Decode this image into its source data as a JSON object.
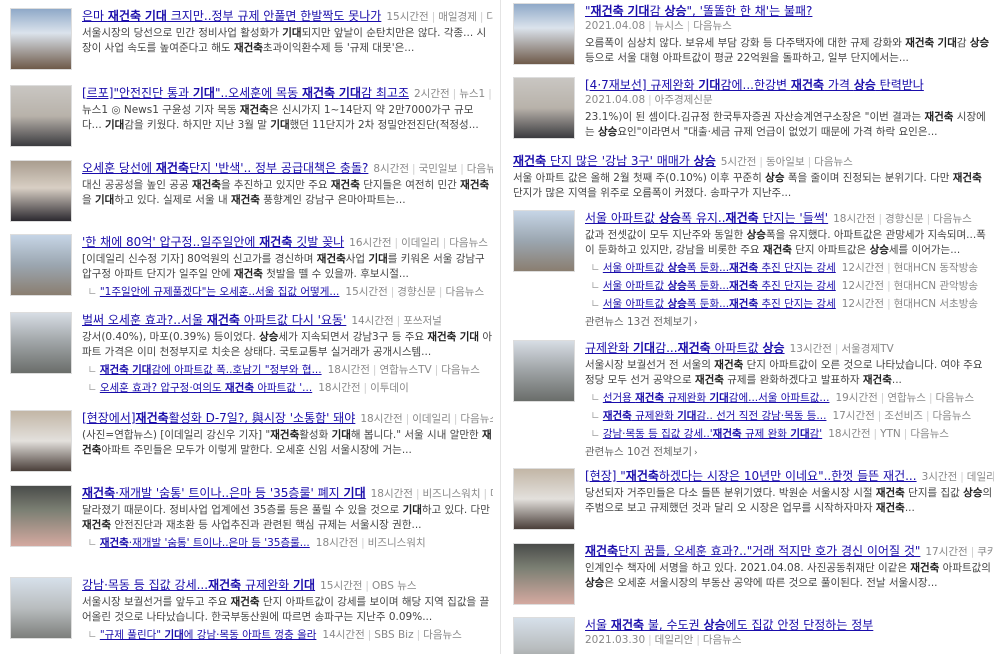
{
  "left": [
    {
      "id": "L1",
      "title": "은마 재건축 기대 크지만..정부 규제 안풀면 한발짝도 못나가",
      "time": "15시간전",
      "source": "매일경제",
      "portal": "다음뉴스",
      "snippet": "서울시장의 당선으로 민간 정비사업 활성화가 기대되지만 앞날이 순탄치만은 않다. 각종... 시장이 사업 속도를 높여준다고 해도 재건축초과이익환수제 등 '규제 대못'은..."
    },
    {
      "id": "L2",
      "title": "[르포]\"안전진단 통과 기대\"..오세훈에 목동 재건축 기대감 최고조",
      "time": "2시간전",
      "source": "뉴스1",
      "portal": "다음뉴스",
      "snippet": "뉴스1 ◎ News1 구윤성 기자 목동 재건축은 신시가지 1~14단지 약 2만7000가구 규모다... 기대감을 키웠다. 하지만 지난 3월 말 기대했던 11단지가 2차 정밀안전진단(적정성..."
    },
    {
      "id": "L3",
      "title": "오세훈 당선에 재건축단지 '반색'.. 정부 공급대책은 충돌?",
      "time": "8시간전",
      "source": "국민일보",
      "portal": "다음뉴스",
      "snippet": "대신 공공성을 높인 공공 재건축을 추진하고 있지만 주요 재건축 단지들은 여전히 민간 재건축을 기대하고 있다. 실제로 서울 내 재건축 풍향계인 강남구 은마아파트는..."
    },
    {
      "id": "L4",
      "title": "'한 채에 80억' 압구정..일주일안에 재건축 깃발 꽂나",
      "time": "16시간전",
      "source": "이데일리",
      "portal": "다음뉴스",
      "snippet": "[이데일리 신수정 기자] 80억원의 신고가를 경신하며 재건축사업 기대를 키워온 서울 강남구 압구정 아파트 단지가 일주일 안에 재건축 첫발을 뗄 수 있을까. 후보시절...",
      "related": [
        {
          "title": "\"1주일안에 규제풀겠다\"는 오세훈..서울 집값 어떻게...",
          "time": "15시간전",
          "source": "경향신문",
          "portal": "다음뉴스"
        }
      ]
    },
    {
      "id": "L5",
      "title": "벌써 오세훈 효과?..서울 재건축 아파트값 다시 '요동'",
      "time": "14시간전",
      "source": "포쓰저널",
      "portal": "",
      "snippet": "강서(0.40%), 마포(0.39%) 등이었다. 상승세가 지속되면서 강남3구 등 주요 재건축 기대 아파트 가격은 이미 천정부지로 치솟은 상태다. 국토교통부 실거래가 공개시스템...",
      "related": [
        {
          "title": "재건축 기대감에 아파트값 폭..호남기 \"정부와 협...",
          "time": "18시간전",
          "source": "연합뉴스TV",
          "portal": "다음뉴스"
        },
        {
          "title": "오세훈 효과? 압구정·여의도 재건축 아파트값 '...",
          "time": "18시간전",
          "source": "이투데이",
          "portal": ""
        }
      ]
    },
    {
      "id": "L6",
      "title": "[현장에서]재건축활성화 D-7일?, 與시장 '소통함' 돼야",
      "time": "18시간전",
      "source": "이데일리",
      "portal": "다음뉴스",
      "snippet": "(사진=연합뉴스) [이데일리 강신우 기자] \"재건축활성화 기대해 봅니다.\" 서울 시내 알만한 재건축아파트 주민들은 모두가 이렇게 말한다. 오세훈 신임 서울시장에 거는..."
    },
    {
      "id": "L7",
      "title": "재건축·재개발 '숨통' 트이나..은마 등 '35층룰' 폐지 기대",
      "time": "18시간전",
      "source": "비즈니스워치",
      "portal": "다음뉴스",
      "snippet": "달라졌기 때문이다. 정비사업 업계에선 35층룰 등은 풀릴 수 있을 것으로 기대하고 있다. 다만 재건축 안전진단과 재초환 등 사업추진과 관련된 핵심 규제는 서울시장 권한...",
      "related": [
        {
          "title": "재건축·재개발 '숨통' 트이나..은마 등 '35층룰...",
          "time": "18시간전",
          "source": "비즈니스워치",
          "portal": ""
        }
      ]
    },
    {
      "id": "L8",
      "title": "강남·목동 등 집값 강세...재건축 규제완화 기대",
      "time": "15시간전",
      "source": "OBS 뉴스",
      "portal": "",
      "snippet": "서울시장 보궐선거를 앞두고 주요 재건축 단지 아파트값이 강세를 보이며 해당 지역 집값을 끌어올린 것으로 나타났습니다. 한국부동산원에 따르면 송파구는 지난주 0.09%...",
      "related": [
        {
          "title": "\"규제 풀린다\" 기대에 강남·목동 아파트 껑충 올라",
          "time": "14시간전",
          "source": "SBS Biz",
          "portal": "다음뉴스"
        }
      ]
    }
  ],
  "right": [
    {
      "id": "R1",
      "title": "\"재건축 기대감 상승\", '똘똘한 한 채'는 불패?",
      "time": "2021.04.08",
      "source": "뉴시스",
      "portal": "다음뉴스",
      "snippet": "오름폭이 심상치 않다. 보유세 부담 강화 등 다주택자에 대한 규제 강화와 재건축 기대감 상승 등으로 서울 대형 아파트값이 평균 22억원을 돌파하고, 일부 단지에서는..."
    },
    {
      "id": "R2",
      "title": "[4·7재보선] 규제완화 기대감에...한강변 재건축 가격 상승 탄력받나",
      "time": "2021.04.08",
      "source": "아주경제신문",
      "portal": "",
      "snippet": "23.1%)이 된 셈이다.김규정 한국투자증권 자산승계연구소장은 \"이번 결과는 재건축 시장에는 상승요인\"이라면서 \"대출·세금 규제 언급이 없었기 때문에 가격 하락 요인은..."
    },
    {
      "id": "R3",
      "title": "재건축 단지 많은 '강남 3구' 매매가 상승",
      "time": "5시간전",
      "source": "동아일보",
      "portal": "다음뉴스",
      "snippet": "서울 아파트 값은 올해 2월 첫째 주(0.10%) 이후 꾸준히 상승 폭을 줄이며 진정되는 분위기다. 다만 재건축 단지가 많은 지역을 위주로 오름폭이 커졌다. 송파구가 지난주..."
    },
    {
      "id": "R4",
      "title": "서울 아파트값 상승폭 유지..재건축 단지는 '들썩'",
      "time": "18시간전",
      "source": "경향신문",
      "portal": "다음뉴스",
      "snippet": "값과 전셋값이 모두 지난주와 동일한 상승폭을 유지했다. 아파트값은 관망세가 지속되며...폭이 둔화하고 있지만, 강남을 비롯한 주요 재건축 단지 아파트값은 상승세를 이어가는...",
      "related": [
        {
          "title": "서울 아파트값 상승폭 둔화...재건축 추진 단지는 강세",
          "time": "12시간전",
          "source": "현대HCN 동작방송",
          "portal": ""
        },
        {
          "title": "서울 아파트값 상승폭 둔화...재건축 추진 단지는 강세",
          "time": "12시간전",
          "source": "현대HCN 관악방송",
          "portal": ""
        },
        {
          "title": "서울 아파트값 상승폭 둔화...재건축 추진 단지는 강세",
          "time": "12시간전",
          "source": "현대HCN 서초방송",
          "portal": ""
        }
      ],
      "more": "관련뉴스 13건 전체보기"
    },
    {
      "id": "R5",
      "title": "규제완화 기대감...재건축 아파트값 상승",
      "time": "13시간전",
      "source": "서울경제TV",
      "portal": "",
      "snippet": "서울시장 보궐선거 전 서울의 재건축 단지 아파트값이 오른 것으로 나타났습니다. 여야 주요 정당 모두 선거 공약으로 재건축 규제를 완화하겠다고 발표하자 재건축...",
      "related": [
        {
          "title": "선거용 재건축 규제완화 기대감에...서울 아파트값...",
          "time": "19시간전",
          "source": "연합뉴스",
          "portal": "다음뉴스"
        },
        {
          "title": "재건축 규제완화 기대감.. 선거 직전 강남·목동 등...",
          "time": "17시간전",
          "source": "조선비즈",
          "portal": "다음뉴스"
        },
        {
          "title": "강남·목동 등 집값 강세..'재건축 규제 완화 기대감'",
          "time": "18시간전",
          "source": "YTN",
          "portal": "다음뉴스"
        }
      ],
      "more": "관련뉴스 10건 전체보기"
    },
    {
      "id": "R6",
      "title": "[현장] \"재건축하겠다는 시장은 10년만 이네요\"..한껏 들뜬 재건...",
      "time": "3시간전",
      "source": "데일리안",
      "portal": "다음뉴스",
      "snippet": "당선되자 거주민들은 다소 들뜬 분위기였다. 박원순 서울시장 시절 재건축 단지를 집값 상승의 주범으로 보고 규제했던 것과 달리 오 시장은 업무를 시작하자마자 재건축..."
    },
    {
      "id": "R7",
      "title": "재건축단지 꿈틀, 오세훈 효과?..\"거래 적지만 호가 경신 이어질 것\"",
      "time": "17시간전",
      "source": "쿠키뉴스",
      "portal": "다음뉴스",
      "snippet": "인계인수 책자에 서명을 하고 있다. 2021.04.08. 사진공동취재단 이같은 재건축 아파트값의 상승은 오세훈 서울시장의 부동산 공약에 따른 것으로 풀이된다. 전날 서울시장..."
    },
    {
      "id": "R8",
      "title": "서울 재건축 불, 수도권 상승에도 집값 안정 단정하는 정부",
      "time": "2021.03.30",
      "source": "데일리안",
      "portal": "다음뉴스",
      "snippet": ""
    }
  ],
  "highlight_words": [
    "재건축",
    "기대",
    "상승"
  ],
  "colors": {
    "link": "#1a0dab",
    "meta": "#888888",
    "snippet": "#444444"
  }
}
